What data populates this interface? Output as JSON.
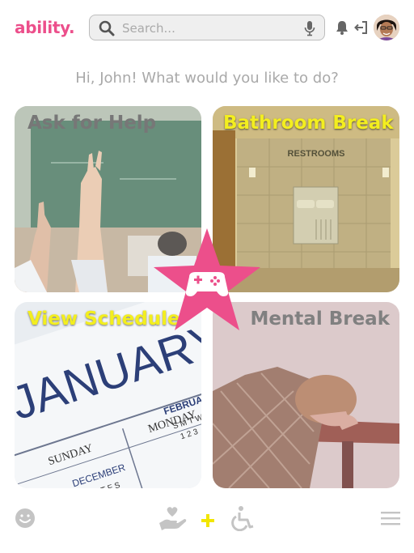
{
  "header": {
    "logo": "ability.",
    "search_placeholder": "Search...",
    "icons": [
      "search-icon",
      "mic-icon",
      "bell-icon",
      "logout-icon",
      "avatar"
    ]
  },
  "greeting": "Hi, John! What would you like to do?",
  "tiles": [
    {
      "label": "Ask for Help",
      "label_color": "#777777"
    },
    {
      "label": "Bathroom Break",
      "label_color": "#f3ee1f",
      "sign": "RESTROOMS"
    },
    {
      "label": "View Schedule",
      "label_color": "#f3ee1f",
      "calendar": {
        "month": "JANUARY",
        "day1": "SUNDAY",
        "day2": "MONDAY",
        "prev": "DECEMBER",
        "next": "FEBRUAR",
        "mini": "S M T W",
        "mini2": "1 2 3",
        "mini3": "M T F S"
      }
    },
    {
      "label": "Mental Break",
      "label_color": "#808080"
    }
  ],
  "center_badge": {
    "icon": "gamepad-icon",
    "color": "#ec4f8b"
  },
  "footer": {
    "icons": [
      "smiley-icon",
      "heart-hand-icon",
      "plus-icon",
      "wheelchair-icon",
      "menu-icon"
    ],
    "accent_plus": "#f2e600"
  },
  "colors": {
    "brand": "#ec4f8b",
    "muted": "#a9a9a9"
  }
}
